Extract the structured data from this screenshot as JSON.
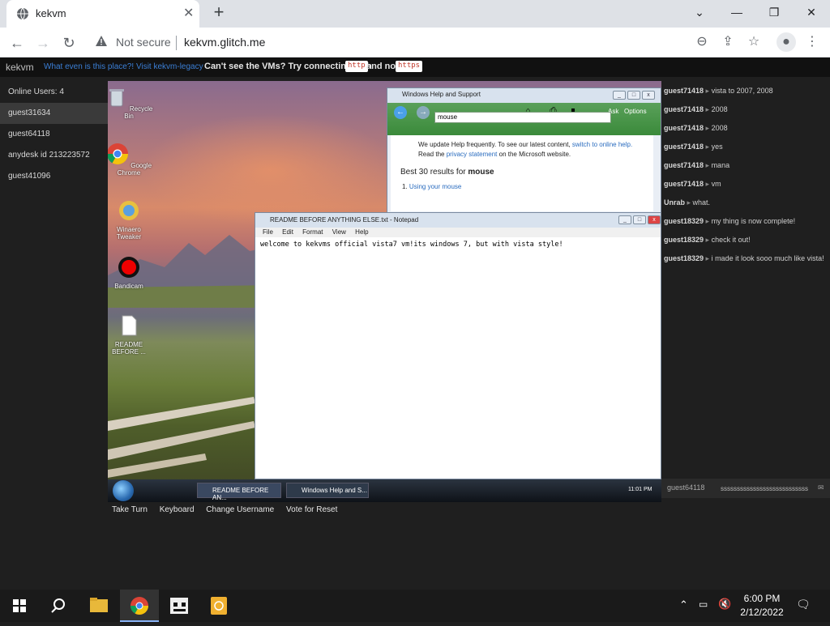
{
  "browser": {
    "tab_title": "kekvm",
    "not_secure": "Not secure",
    "url": "kekvm.glitch.me"
  },
  "topbar": {
    "brand": "kekvm",
    "link1": "What even is this place?!",
    "link2": "Visit kekvm-legacy",
    "notice_pre": "Can't see the VMs? Try connecting with",
    "code_http": "http",
    "notice_and": "and not",
    "code_https": "https"
  },
  "users": {
    "title": "Online Users: 4",
    "items": [
      "guest31634",
      "guest64118",
      "anydesk id 213223572",
      "guest41096"
    ]
  },
  "vm": {
    "desktop_icons": [
      "Recycle Bin",
      "Google Chrome",
      "Winaero Tweaker",
      "Bandicam",
      "README BEFORE ..."
    ],
    "help_window": {
      "title": "Windows Help and Support",
      "ask": "Ask",
      "options": "Options",
      "search_value": "mouse",
      "info_line1_pre": "We update Help frequently. To see our latest content,",
      "info_link1": "switch to online help.",
      "info_line2_pre": "Read the",
      "info_link2": "privacy statement",
      "info_line2_post": "on the Microsoft website.",
      "best_pre": "Best 30 results for",
      "best_term": "mouse",
      "result1_num": "1.",
      "result1": "Using your mouse"
    },
    "notepad": {
      "title": "README BEFORE ANYTHING ELSE.txt - Notepad",
      "menu": [
        "File",
        "Edit",
        "Format",
        "View",
        "Help"
      ],
      "content": "welcome to kekvms official vista7 vm!its windows 7, but with vista style!"
    },
    "taskbar": {
      "task1": "README BEFORE AN...",
      "task2": "Windows Help and S...",
      "clock": "11:01 PM"
    }
  },
  "chat": {
    "messages": [
      {
        "user": "guest71418",
        "text": "vista to 2007, 2008"
      },
      {
        "user": "guest71418",
        "text": "2008"
      },
      {
        "user": "guest71418",
        "text": "2008"
      },
      {
        "user": "guest71418",
        "text": "yes"
      },
      {
        "user": "guest71418",
        "text": "mana"
      },
      {
        "user": "guest71418",
        "text": "vm"
      },
      {
        "user": "Unrab",
        "text": "what."
      },
      {
        "user": "guest18329",
        "text": "my thing is now complete!"
      },
      {
        "user": "guest18329",
        "text": "check it out!"
      },
      {
        "user": "guest18329",
        "text": "i made it look sooo much like vista!"
      }
    ],
    "my_name": "guest64118",
    "input_value": "sssssssssssssssssssssssssss"
  },
  "actions": [
    "Take Turn",
    "Keyboard",
    "Change Username",
    "Vote for Reset"
  ],
  "taskbar": {
    "time": "6:00 PM",
    "date": "2/12/2022"
  },
  "colors": {
    "accent_link": "#3b7fd6",
    "page_bg": "#1f1f1f",
    "http_code": "#c0392b"
  }
}
